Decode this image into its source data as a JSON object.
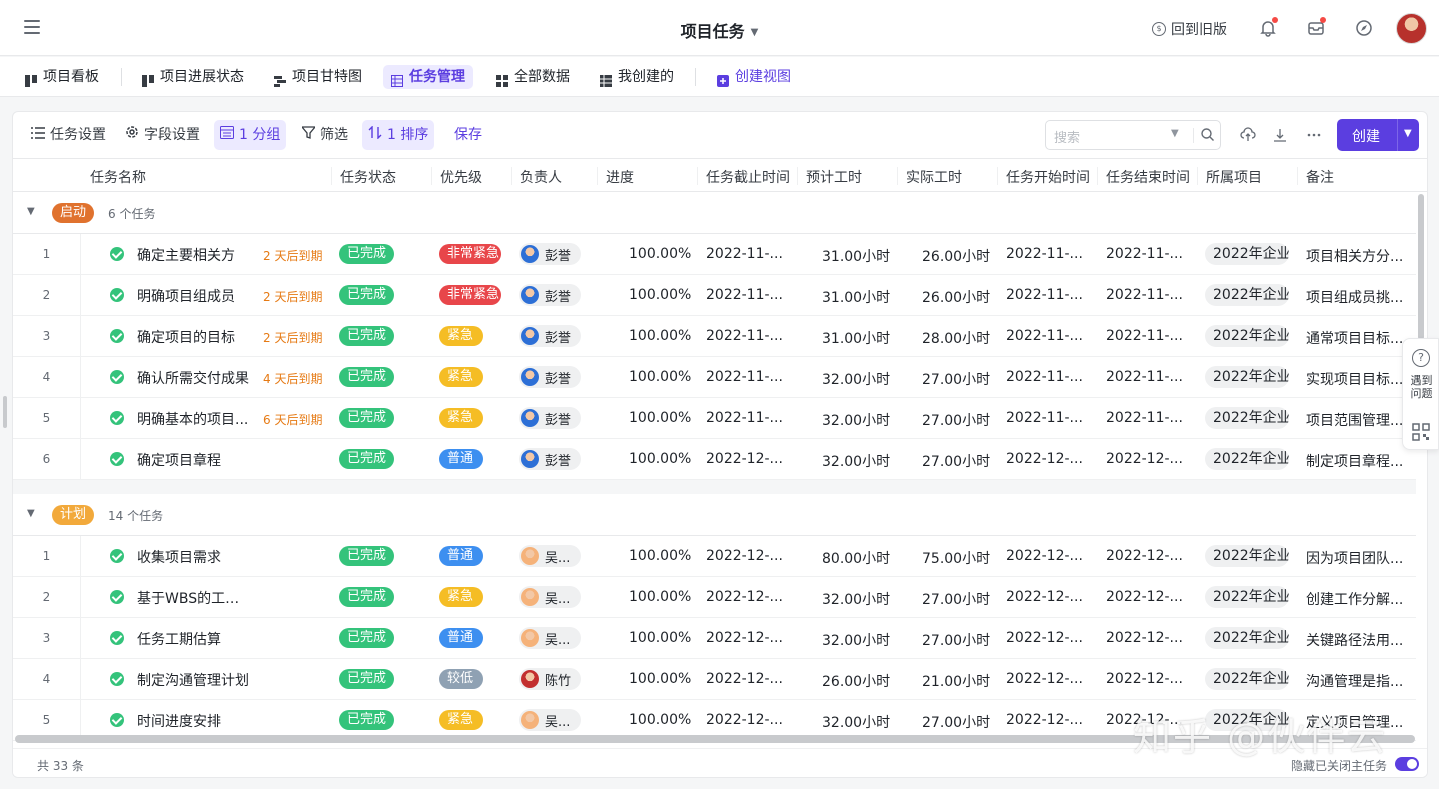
{
  "header": {
    "title": "项目任务",
    "back_old": "回到旧版"
  },
  "view_tabs": [
    {
      "label": "项目看板"
    },
    {
      "label": "项目进展状态"
    },
    {
      "label": "项目甘特图"
    },
    {
      "label": "任务管理"
    },
    {
      "label": "全部数据"
    },
    {
      "label": "我创建的"
    },
    {
      "label": "创建视图"
    }
  ],
  "toolbar": {
    "task_settings": "任务设置",
    "field_settings": "字段设置",
    "group": "1 分组",
    "filter": "筛选",
    "sort": "1 排序",
    "save": "保存",
    "search_placeholder": "搜索",
    "create": "创建"
  },
  "columns": [
    "任务名称",
    "任务状态",
    "优先级",
    "负责人",
    "进度",
    "任务截止时间",
    "预计工时",
    "实际工时",
    "任务开始时间",
    "任务结束时间",
    "所属项目",
    "备注"
  ],
  "colors": {
    "accent": "#5b3ee0",
    "done": "#34c37b",
    "urgent_high": "#e8464a",
    "urgent": "#f5bd25",
    "normal": "#3d8ff0",
    "low": "#8fa1b3",
    "group_start": "#e0722e",
    "group_plan": "#f2a93b"
  },
  "groups": [
    {
      "label": "启动",
      "count": "6 个任务",
      "rows": [
        {
          "idx": "1",
          "name": "确定主要相关方",
          "due": "2 天后到期",
          "status": "已完成",
          "priority": "非常紧急",
          "owner": "彭誉",
          "progress": "100.00%",
          "deadline": "2022-11-...",
          "est": "31.00小时",
          "act": "26.00小时",
          "start": "2022-11-...",
          "end": "2022-11-...",
          "project": "2022年企业",
          "note": "项目相关方分..."
        },
        {
          "idx": "2",
          "name": "明确项目组成员",
          "due": "2 天后到期",
          "status": "已完成",
          "priority": "非常紧急",
          "owner": "彭誉",
          "progress": "100.00%",
          "deadline": "2022-11-...",
          "est": "31.00小时",
          "act": "26.00小时",
          "start": "2022-11-...",
          "end": "2022-11-...",
          "project": "2022年企业",
          "note": "项目组成员挑..."
        },
        {
          "idx": "3",
          "name": "确定项目的目标",
          "due": "2 天后到期",
          "status": "已完成",
          "priority": "紧急",
          "owner": "彭誉",
          "progress": "100.00%",
          "deadline": "2022-11-...",
          "est": "31.00小时",
          "act": "28.00小时",
          "start": "2022-11-...",
          "end": "2022-11-...",
          "project": "2022年企业",
          "note": "通常项目目标..."
        },
        {
          "idx": "4",
          "name": "确认所需交付成果",
          "due": "4 天后到期",
          "status": "已完成",
          "priority": "紧急",
          "owner": "彭誉",
          "progress": "100.00%",
          "deadline": "2022-11-...",
          "est": "32.00小时",
          "act": "27.00小时",
          "start": "2022-11-...",
          "end": "2022-11-...",
          "project": "2022年企业",
          "note": "实现项目目标..."
        },
        {
          "idx": "5",
          "name": "明确基本的项目...",
          "due": "6 天后到期",
          "status": "已完成",
          "priority": "紧急",
          "owner": "彭誉",
          "progress": "100.00%",
          "deadline": "2022-11-...",
          "est": "32.00小时",
          "act": "27.00小时",
          "start": "2022-11-...",
          "end": "2022-11-...",
          "project": "2022年企业",
          "note": "项目范围管理..."
        },
        {
          "idx": "6",
          "name": "确定项目章程",
          "due": "",
          "status": "已完成",
          "priority": "普通",
          "owner": "彭誉",
          "progress": "100.00%",
          "deadline": "2022-12-...",
          "est": "32.00小时",
          "act": "27.00小时",
          "start": "2022-12-...",
          "end": "2022-12-...",
          "project": "2022年企业",
          "note": "制定项目章程..."
        }
      ]
    },
    {
      "label": "计划",
      "count": "14 个任务",
      "rows": [
        {
          "idx": "1",
          "name": "收集项目需求",
          "due": "",
          "status": "已完成",
          "priority": "普通",
          "owner": "吴...",
          "progress": "100.00%",
          "deadline": "2022-12-...",
          "est": "80.00小时",
          "act": "75.00小时",
          "start": "2022-12-...",
          "end": "2022-12-...",
          "project": "2022年企业",
          "note": "因为项目团队..."
        },
        {
          "idx": "2",
          "name": "基于WBS的工作任务拆解",
          "due": "",
          "status": "已完成",
          "priority": "紧急",
          "owner": "吴...",
          "progress": "100.00%",
          "deadline": "2022-12-...",
          "est": "32.00小时",
          "act": "27.00小时",
          "start": "2022-12-...",
          "end": "2022-12-...",
          "project": "2022年企业",
          "note": "创建工作分解..."
        },
        {
          "idx": "3",
          "name": "任务工期估算",
          "due": "",
          "status": "已完成",
          "priority": "普通",
          "owner": "吴...",
          "progress": "100.00%",
          "deadline": "2022-12-...",
          "est": "32.00小时",
          "act": "27.00小时",
          "start": "2022-12-...",
          "end": "2022-12-...",
          "project": "2022年企业",
          "note": "关键路径法用..."
        },
        {
          "idx": "4",
          "name": "制定沟通管理计划",
          "due": "",
          "status": "已完成",
          "priority": "较低",
          "owner": "陈竹",
          "progress": "100.00%",
          "deadline": "2022-12-...",
          "est": "26.00小时",
          "act": "21.00小时",
          "start": "2022-12-...",
          "end": "2022-12-...",
          "project": "2022年企业",
          "note": "沟通管理是指..."
        },
        {
          "idx": "5",
          "name": "时间进度安排",
          "due": "",
          "status": "已完成",
          "priority": "紧急",
          "owner": "吴...",
          "progress": "100.00%",
          "deadline": "2022-12-...",
          "est": "32.00小时",
          "act": "27.00小时",
          "start": "2022-12-...",
          "end": "2022-12-...",
          "project": "2022年企业",
          "note": "定义项目管理..."
        }
      ]
    }
  ],
  "footer": {
    "total": "共 33 条",
    "hide_closed": "隐藏已关闭主任务"
  },
  "side_help": {
    "label": "遇到问题"
  },
  "watermark": "知乎 @伙伴云"
}
